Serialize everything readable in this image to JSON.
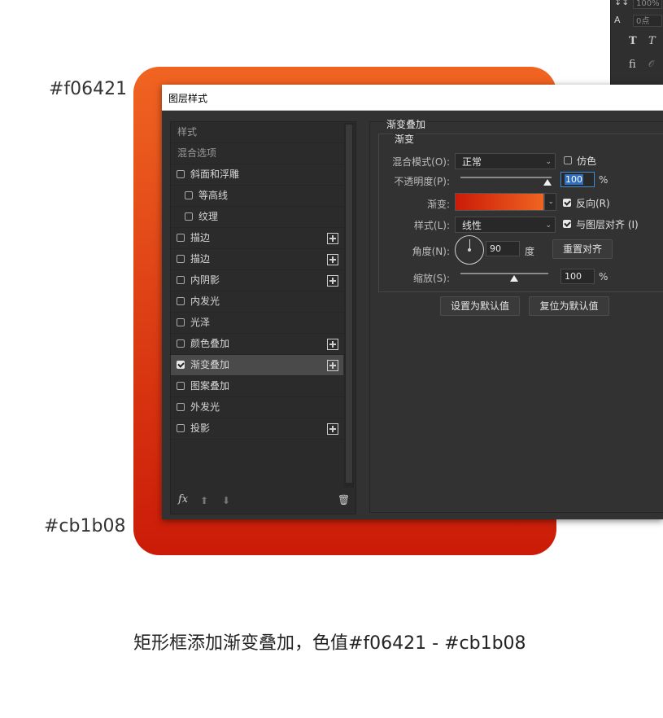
{
  "labels": {
    "top_color": "#f06421",
    "bottom_color": "#cb1b08"
  },
  "colors": {
    "gradient_top": "#f06421",
    "gradient_bottom": "#cb1b08"
  },
  "caption": "矩形框添加渐变叠加，色值#f06421 - #cb1b08",
  "char_panel": {
    "leading": "100%",
    "tracking_value": "0点",
    "tracking_icon": "A",
    "bold_icon": "T",
    "italic_icon": "T",
    "ligature_icon": "fi",
    "ligature_alt": "𝒪"
  },
  "dialog": {
    "title": "图层样式",
    "list": {
      "header": "样式",
      "blend_options": "混合选项",
      "items": [
        {
          "label": "斜面和浮雕",
          "checked": false,
          "plus": false,
          "indent": false
        },
        {
          "label": "等高线",
          "checked": false,
          "plus": false,
          "indent": true
        },
        {
          "label": "纹理",
          "checked": false,
          "plus": false,
          "indent": true
        },
        {
          "label": "描边",
          "checked": false,
          "plus": true,
          "indent": false
        },
        {
          "label": "描边",
          "checked": false,
          "plus": true,
          "indent": false
        },
        {
          "label": "内阴影",
          "checked": false,
          "plus": true,
          "indent": false
        },
        {
          "label": "内发光",
          "checked": false,
          "plus": false,
          "indent": false
        },
        {
          "label": "光泽",
          "checked": false,
          "plus": false,
          "indent": false
        },
        {
          "label": "颜色叠加",
          "checked": false,
          "plus": true,
          "indent": false
        },
        {
          "label": "渐变叠加",
          "checked": true,
          "plus": true,
          "indent": false,
          "selected": true
        },
        {
          "label": "图案叠加",
          "checked": false,
          "plus": false,
          "indent": false
        },
        {
          "label": "外发光",
          "checked": false,
          "plus": false,
          "indent": false
        },
        {
          "label": "投影",
          "checked": false,
          "plus": true,
          "indent": false
        }
      ],
      "footer": {
        "fx": "fx",
        "up": "⬆",
        "down": "⬇",
        "trash": "🗑"
      }
    },
    "panel": {
      "section_title": "渐变叠加",
      "group_title": "渐变",
      "blend_mode_label": "混合模式(O):",
      "blend_mode_value": "正常",
      "dither_label": "仿色",
      "dither_checked": false,
      "opacity_label": "不透明度(P):",
      "opacity_value": "100",
      "opacity_unit": "%",
      "gradient_label": "渐变:",
      "reverse_label": "反向(R)",
      "reverse_checked": true,
      "style_label": "样式(L):",
      "style_value": "线性",
      "align_label": "与图层对齐 (I)",
      "align_checked": true,
      "angle_label": "角度(N):",
      "angle_value": "90",
      "angle_unit": "度",
      "reset_align_button": "重置对齐",
      "scale_label": "缩放(S):",
      "scale_value": "100",
      "scale_unit": "%",
      "set_default_button": "设置为默认值",
      "reset_default_button": "复位为默认值"
    }
  }
}
